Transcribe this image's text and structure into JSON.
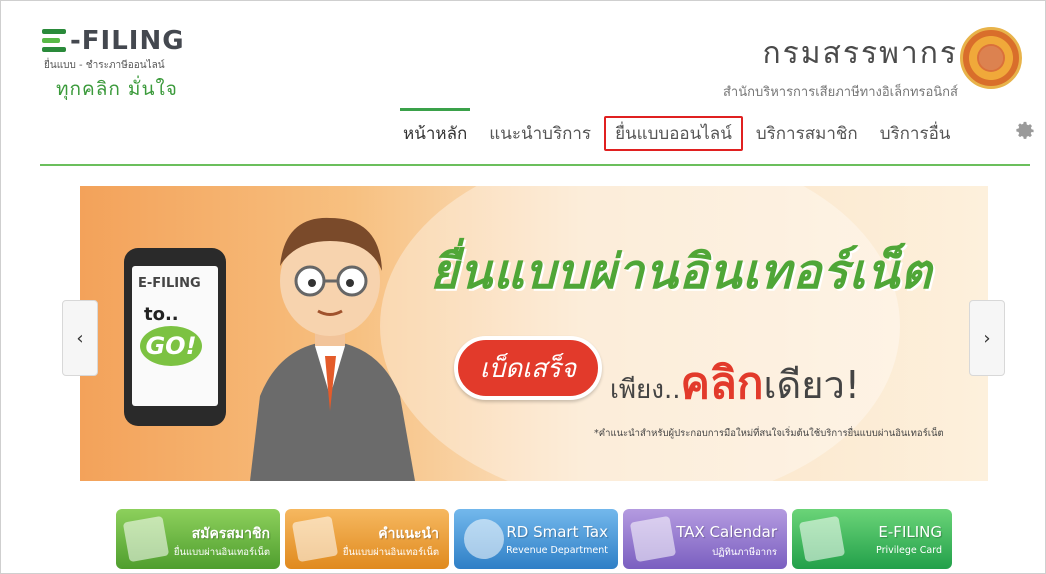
{
  "header": {
    "logo_text": "-FILING",
    "logo_sub": "ยื่นแบบ - ชำระภาษีออนไลน์",
    "slogan": "ทุกคลิก มั่นใจ",
    "dept_name": "กรมสรรพากร",
    "dept_sub": "สำนักบริหารการเสียภาษีทางอิเล็กทรอนิกส์"
  },
  "nav": {
    "items": [
      {
        "label": "หน้าหลัก"
      },
      {
        "label": "แนะนำบริการ"
      },
      {
        "label": "ยื่นแบบออนไลน์"
      },
      {
        "label": "บริการสมาชิก"
      },
      {
        "label": "บริการอื่น"
      }
    ],
    "active_index": 0,
    "highlight_index": 2
  },
  "banner": {
    "headline": "ยื่นแบบผ่านอินเทอร์เน็ต",
    "pill_text": "เบ็ดเสร็จ",
    "pre_text": "เพียง..",
    "big_text": "คลิก",
    "post_text": "เดียว!",
    "note": "*คำแนะนำสำหรับผู้ประกอบการมือใหม่ที่สนใจเริ่มต้นใช้บริการยื่นแบบผ่านอินเทอร์เน็ต",
    "phone_logo": "E-FILING",
    "phone_to": "to..",
    "phone_go": "GO!",
    "prev_arrow": "‹",
    "next_arrow": "›"
  },
  "quick_links": [
    {
      "title": "สมัครสมาชิก",
      "subtitle": "ยื่นแบบผ่านอินเทอร์เน็ต",
      "color": "#5aab38"
    },
    {
      "title": "คำแนะนำ",
      "subtitle": "ยื่นแบบผ่านอินเทอร์เน็ต",
      "color": "#eb9a2c"
    },
    {
      "title": "RD Smart Tax",
      "subtitle": "Revenue Department",
      "color": "#3e8fd4"
    },
    {
      "title": "TAX Calendar",
      "subtitle": "ปฏิทินภาษีอากร",
      "color": "#8b6fcc"
    },
    {
      "title": "E-FILING",
      "subtitle": "Privilege Card",
      "color": "#2faa55"
    }
  ]
}
